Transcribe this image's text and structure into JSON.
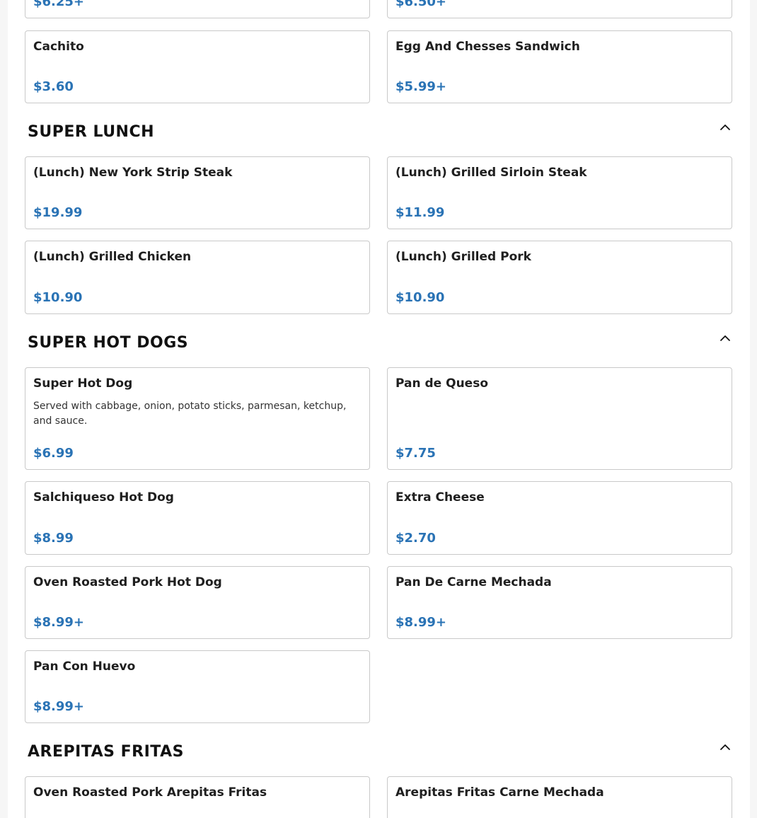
{
  "top_row": {
    "left_price": "$6.25+",
    "right_price": "$6.50+"
  },
  "breakfast_items": [
    {
      "name": "Cachito",
      "price": "$3.60"
    },
    {
      "name": "Egg And Chesses Sandwich",
      "price": "$5.99+"
    }
  ],
  "sections": [
    {
      "title": "SUPER LUNCH",
      "items": [
        {
          "name": "(Lunch) New York Strip Steak",
          "price": "$19.99"
        },
        {
          "name": "(Lunch) Grilled Sirloin Steak",
          "price": "$11.99"
        },
        {
          "name": "(Lunch) Grilled Chicken",
          "price": "$10.90"
        },
        {
          "name": "(Lunch) Grilled Pork",
          "price": "$10.90"
        }
      ]
    },
    {
      "title": "SUPER HOT DOGS",
      "items": [
        {
          "name": "Super Hot Dog",
          "description": "Served with cabbage, onion, potato sticks, parmesan, ketchup, and sauce.",
          "price": "$6.99"
        },
        {
          "name": "Pan de Queso",
          "price": "$7.75"
        },
        {
          "name": "Salchiqueso Hot Dog",
          "price": "$8.99"
        },
        {
          "name": "Extra Cheese",
          "price": "$2.70"
        },
        {
          "name": "Oven Roasted Pork Hot Dog",
          "price": "$8.99+"
        },
        {
          "name": "Pan De Carne Mechada",
          "price": "$8.99+"
        },
        {
          "name": "Pan Con Huevo",
          "price": "$8.99+"
        }
      ]
    },
    {
      "title": "AREPITAS FRITAS",
      "items": [
        {
          "name": "Oven Roasted Pork Arepitas Fritas"
        },
        {
          "name": "Arepitas Fritas Carne Mechada"
        }
      ]
    }
  ],
  "icons": {
    "collapse": "chevron-up-icon"
  },
  "colors": {
    "price": "#2a73b5",
    "border": "#c9c9c9"
  }
}
